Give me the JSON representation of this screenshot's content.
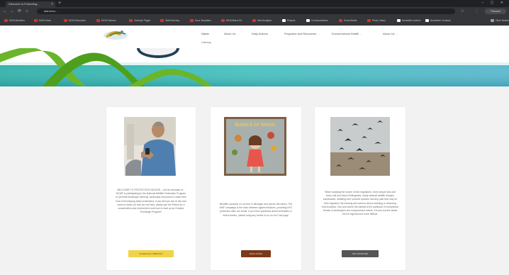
{
  "browser": {
    "tab_title": "Welcome to Protecting...",
    "tab_close": "×",
    "new_tab": "+",
    "window_controls": "– ▢ ✕",
    "nav": {
      "back": "←",
      "forward": "→",
      "reload": "⟳",
      "home": "⌂"
    },
    "url": "idahoeco...",
    "star": "☆",
    "extensions": "⋮",
    "profile": "Paused",
    "bookmarks": [
      {
        "label": "MCM Members",
        "color": "#d93025"
      },
      {
        "label": "MCM Home",
        "color": "#d93025"
      },
      {
        "label": "MCM Resources",
        "color": "#d93025"
      },
      {
        "label": "MCM Partners",
        "color": "#d93025"
      },
      {
        "label": "Outreach Pages",
        "color": "#d93025"
      },
      {
        "label": "Staff Directory",
        "color": "#d93025"
      },
      {
        "label": "Docs Templates",
        "color": "#d93025"
      },
      {
        "label": "MCM Brand Kit",
        "color": "#d93025"
      },
      {
        "label": "Web Analytics",
        "color": "#d93025"
      },
      {
        "label": "Projects",
        "color": "#ffffff"
      },
      {
        "label": "Communications",
        "color": "#ffffff"
      },
      {
        "label": "Social Media",
        "color": "#d93025"
      },
      {
        "label": "Photo Library",
        "color": "#d93025"
      },
      {
        "label": "Newsletter Archive",
        "color": "#ffffff"
      },
      {
        "label": "Newsletter Contacts",
        "color": "#ffffff"
      },
      {
        "label": "Other Bookmarks",
        "color": "#9aa0a6"
      }
    ]
  },
  "site": {
    "menu": [
      {
        "label": "Home",
        "active": true
      },
      {
        "label": "About Us",
        "caret": "⌄"
      },
      {
        "label": "Daily Actions",
        "caret": "⌄"
      },
      {
        "label": "Programs and Resources",
        "caret": "⌄"
      },
      {
        "label": "Environmental Health",
        "caret": "⌄"
      },
      {
        "label": "About Us",
        "caret": "⌄"
      }
    ],
    "home_sub": "Gateway"
  },
  "cards": [
    {
      "text": "WELCOME TO PROTECTING NATURE – not our decades of... NCWF is participating in the National Wildlife Federation Program to promote landscape diversity, landscape resources to make their kind of developing basic protections. If you feel you are at risk and want to check out how we can help, please join the Parent for a conservation and environment and how to start up an Outdoor Exchange Program!",
      "button": "SCHEDULE A MEETING",
      "button_style": "yellow"
    },
    {
      "text": "Benefits occasion on us here in Michigan and across the nation. The NWF campaign is the town between against illusions, providing NYC protection after our locals. If you have questions about schedules or where twelve, please bring any further to us on our Post page.",
      "button": "READ MORE",
      "button_style": "brown",
      "image_title": "BUNDLE OF BIRDS!"
    },
    {
      "text": "When studying the nature of bird migrations, every simple bird and every call and Jason Rollingeries, study national wildlife refuges, sanctuaries, detailing over summer species and any path that may on their migration. By learning and science about breeding & observing bird locations, how and where the habitat of the particular of exceptional threats in landscapes and compounded events, it found current status bird of regional and more difficult.",
      "button": "GET INVOLVED",
      "button_style": "dark"
    }
  ]
}
